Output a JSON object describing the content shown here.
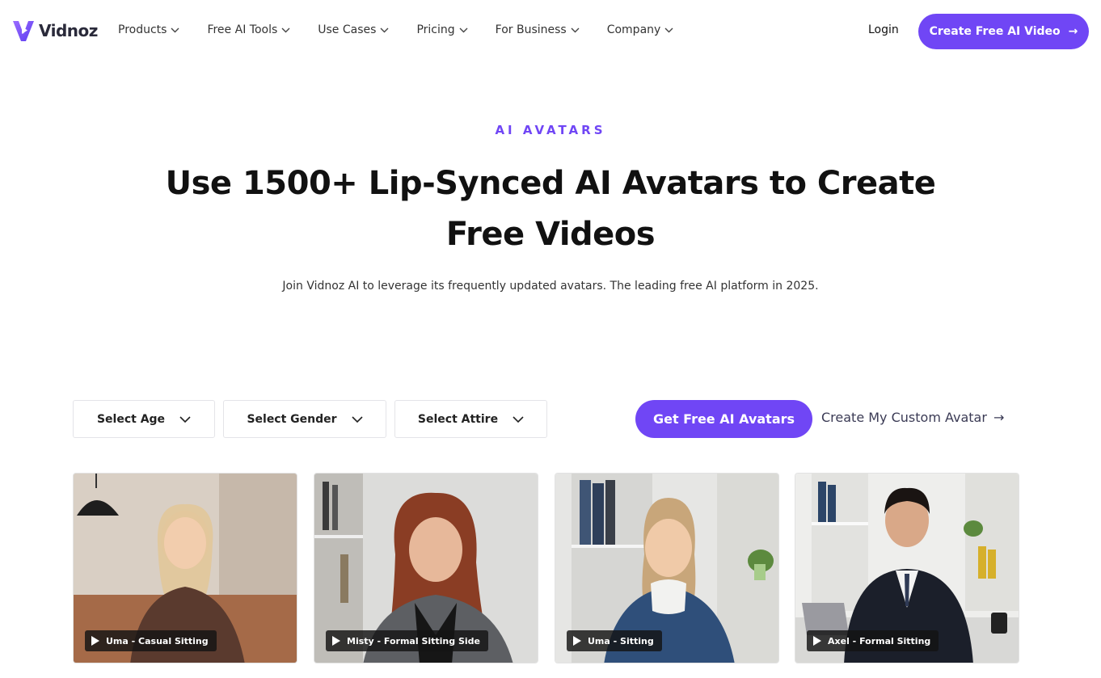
{
  "brand": {
    "name": "Vidnoz",
    "accent": "#7046f5"
  },
  "nav": {
    "items": [
      {
        "label": "Products"
      },
      {
        "label": "Free AI Tools"
      },
      {
        "label": "Use Cases"
      },
      {
        "label": "Pricing"
      },
      {
        "label": "For Business"
      },
      {
        "label": "Company"
      }
    ],
    "login": "Login",
    "cta": "Create Free AI Video"
  },
  "hero": {
    "eyebrow": "AI AVATARS",
    "title": "Use 1500+ Lip-Synced AI Avatars to Create Free Videos",
    "subtitle": "Join Vidnoz AI to leverage its frequently updated avatars. The leading free AI platform in 2025."
  },
  "filters": {
    "age": "Select Age",
    "gender": "Select Gender",
    "attire": "Select Attire"
  },
  "actions": {
    "get_avatars": "Get Free AI Avatars",
    "custom_avatar": "Create My Custom Avatar"
  },
  "avatars": [
    {
      "label": "Uma - Casual Sitting"
    },
    {
      "label": "Misty - Formal Sitting Side"
    },
    {
      "label": "Uma - Sitting"
    },
    {
      "label": "Axel - Formal Sitting"
    }
  ],
  "icons": [
    "vidnoz-logo-icon",
    "chevron-down-icon",
    "arrow-right-icon",
    "play-icon"
  ]
}
